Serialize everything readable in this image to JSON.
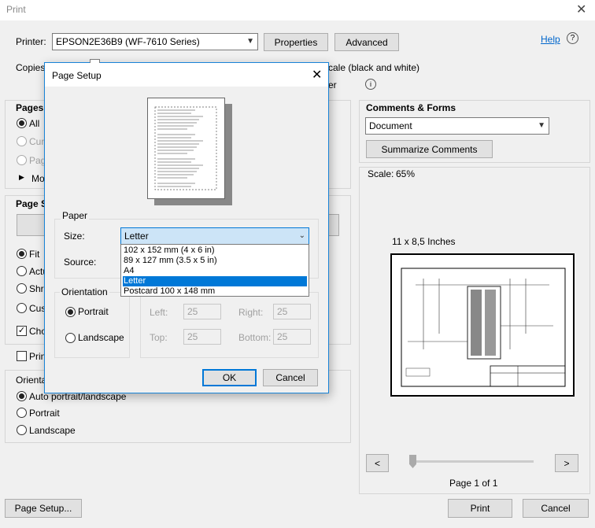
{
  "window": {
    "title": "Print"
  },
  "printer": {
    "label": "Printer:",
    "selected": "EPSON2E36B9 (WF-7610 Series)",
    "properties_label": "Properties",
    "advanced_label": "Advanced",
    "help_label": "Help"
  },
  "copies": {
    "label": "Copies",
    "grayscale_label": "cale (black and white)",
    "ink_label": "er"
  },
  "pages": {
    "heading": "Pages",
    "all_label": "All",
    "current_label": "Cur",
    "pages_label": "Pag",
    "more_label": "Mo"
  },
  "page_sizing": {
    "heading": "Page S",
    "fit_label": "Fit",
    "actual_label": "Actu",
    "shrink_label": "Shri",
    "custom_label": "Cus",
    "choose_label": "Cho",
    "print_on_label": "Prin"
  },
  "orientation": {
    "heading": "Orienta",
    "auto_label": "Auto portrait/landscape",
    "portrait_label": "Portrait",
    "landscape_label": "Landscape"
  },
  "comments": {
    "heading": "Comments & Forms",
    "selected": "Document",
    "summarize_label": "Summarize Comments"
  },
  "preview": {
    "scale_label": "Scale:",
    "scale_value": "65%",
    "paper_size": "11 x 8,5 Inches",
    "page_info": "Page 1 of 1",
    "prev_label": "<",
    "next_label": ">"
  },
  "footer": {
    "page_setup_label": "Page Setup...",
    "print_label": "Print",
    "cancel_label": "Cancel"
  },
  "page_setup_dialog": {
    "title": "Page Setup",
    "paper_group": "Paper",
    "size_label": "Size:",
    "size_selected": "Letter",
    "source_label": "Source:",
    "size_options": [
      "102 x 152 mm (4 x 6 in)",
      "89 x 127 mm (3.5 x 5 in)",
      "A4",
      "Letter",
      "Postcard 100 x 148 mm"
    ],
    "orientation_group": "Orientation",
    "portrait_label": "Portrait",
    "landscape_label": "Landscape",
    "margins": {
      "left_label": "Left:",
      "left_value": "25",
      "right_label": "Right:",
      "right_value": "25",
      "top_label": "Top:",
      "top_value": "25",
      "bottom_label": "Bottom:",
      "bottom_value": "25"
    },
    "ok_label": "OK",
    "cancel_label": "Cancel"
  }
}
